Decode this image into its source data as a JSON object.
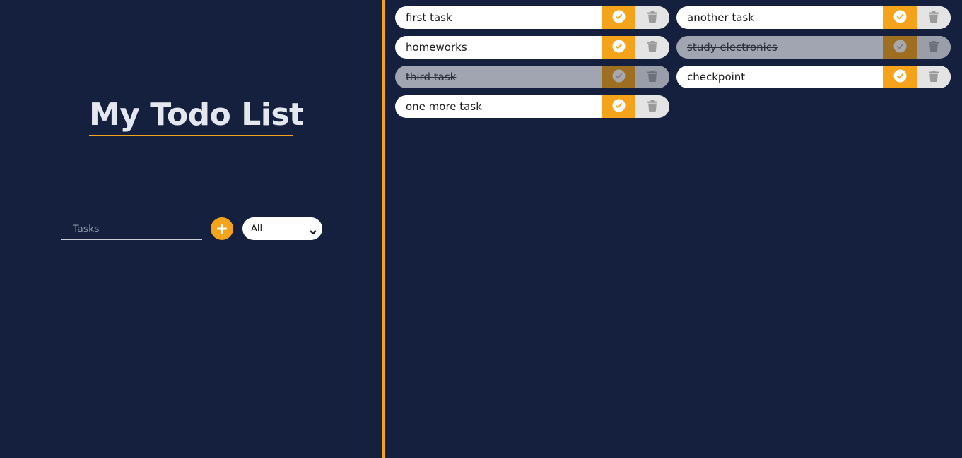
{
  "header": {
    "title": "My Todo List"
  },
  "form": {
    "task_placeholder": "Tasks",
    "task_value": "",
    "add_icon": "plus-icon",
    "filter_selected": "All",
    "filter_options": [
      "All"
    ]
  },
  "todos": [
    {
      "text": "first task",
      "completed": false
    },
    {
      "text": "another task",
      "completed": false
    },
    {
      "text": "homeworks",
      "completed": false
    },
    {
      "text": "study electronics",
      "completed": true
    },
    {
      "text": "third task",
      "completed": true
    },
    {
      "text": "checkpoint",
      "completed": false
    },
    {
      "text": "one more task",
      "completed": false
    }
  ],
  "icons": {
    "complete": "check-circle-icon",
    "delete": "trash-icon"
  },
  "colors": {
    "background": "#14203d",
    "accent": "#f5a31a",
    "title": "#e4e7ee",
    "item_background": "#ffffff",
    "completed_item_background": "#a1a5b1",
    "trash_background": "#e4e4e4"
  }
}
